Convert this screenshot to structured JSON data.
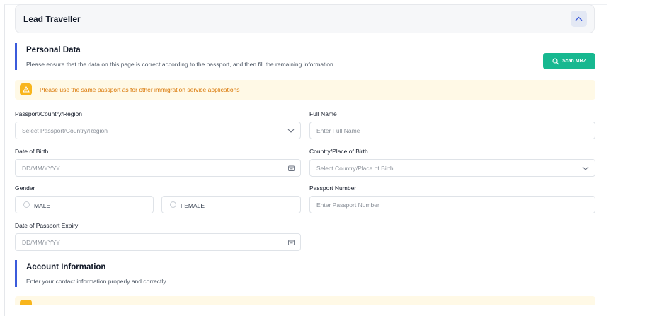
{
  "lead_traveller": {
    "title": "Lead Traveller"
  },
  "personal_data": {
    "title": "Personal Data",
    "description": "Please ensure that the data on this page is correct according to the passport, and then fill the remaining information.",
    "scan_label": "Scan MRZ"
  },
  "alert": {
    "text": "Please use the same passport as for other immigration service applications"
  },
  "fields": {
    "passport_country": {
      "label": "Passport/Country/Region",
      "placeholder": "Select Passport/Country/Region"
    },
    "full_name": {
      "label": "Full Name",
      "placeholder": "Enter Full Name"
    },
    "date_of_birth": {
      "label": "Date of Birth",
      "placeholder": "DD/MM/YYYY"
    },
    "place_of_birth": {
      "label": "Country/Place of Birth",
      "placeholder": "Select Country/Place of Birth"
    },
    "gender": {
      "label": "Gender",
      "options": [
        "MALE",
        "FEMALE"
      ]
    },
    "passport_number": {
      "label": "Passport Number",
      "placeholder": "Enter Passport Number"
    },
    "passport_expiry": {
      "label": "Date of Passport Expiry",
      "placeholder": "DD/MM/YYYY"
    }
  },
  "account_info": {
    "title": "Account Information",
    "description": "Enter your contact information properly and correctly."
  },
  "colors": {
    "accent": "#3b5bdb",
    "scan_button": "#17b890",
    "alert_bg": "#fff9e6",
    "alert_text": "#d97706"
  }
}
